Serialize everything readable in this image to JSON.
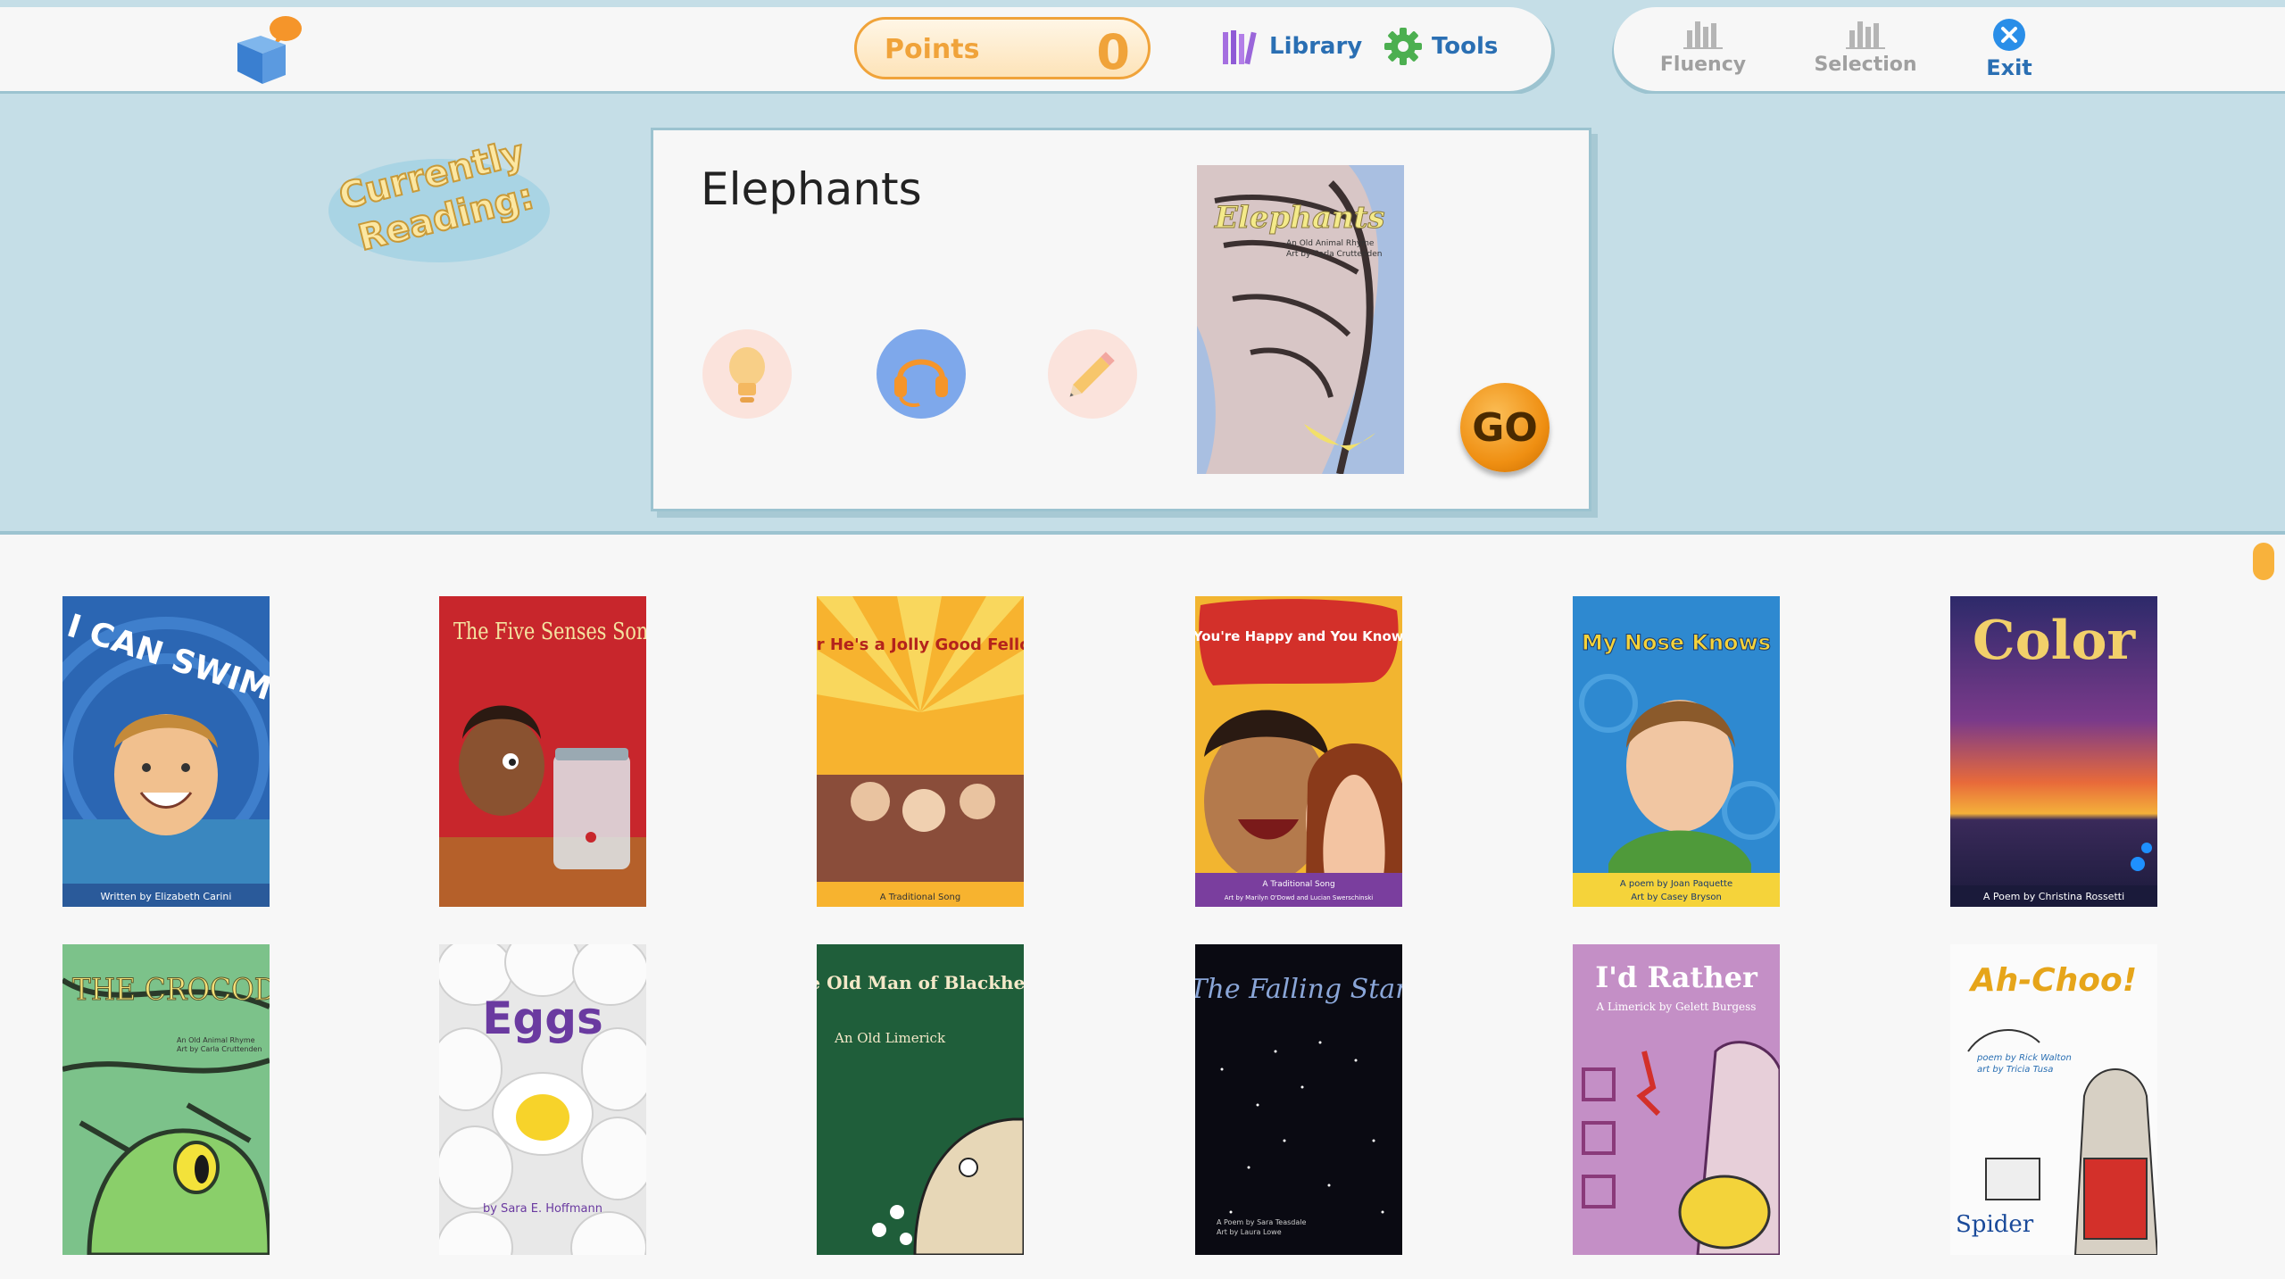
{
  "header": {
    "points_label": "Points",
    "points_value": "0",
    "library_label": "Library",
    "tools_label": "Tools",
    "fluency_label": "Fluency",
    "selection_label": "Selection",
    "exit_label": "Exit"
  },
  "current": {
    "badge_line1": "Currently",
    "badge_line2": "Reading:",
    "title": "Elephants",
    "go_label": "GO",
    "cover": {
      "title": "Elephants",
      "subtitle": "An Old Animal Rhyme",
      "credit": "Art by Carla Cruttenden"
    }
  },
  "books": [
    {
      "title": "I CAN SWIM",
      "credit": "Written by Elizabeth Carini"
    },
    {
      "title": "The Five Senses Song",
      "credit": ""
    },
    {
      "title": "For He's a Jolly Good Fellow",
      "credit": "A Traditional Song"
    },
    {
      "title": "If You're Happy and You Know It",
      "credit": "A Traditional Song",
      "credit2": "Art by Marilyn O'Dowd and Lucian Swerschinski"
    },
    {
      "title": "My Nose Knows",
      "credit": "A poem by Joan Paquette",
      "credit2": "Art by Casey Bryson"
    },
    {
      "title": "Color",
      "credit": "A Poem by Christina Rossetti"
    },
    {
      "title": "THE CROCODILE",
      "credit": "An Old Animal Rhyme",
      "credit2": "Art by Carla Cruttenden"
    },
    {
      "title": "Eggs",
      "credit": "by Sara E. Hoffmann"
    },
    {
      "title": "The Old Man of Blackheath",
      "credit": "An Old Limerick"
    },
    {
      "title": "The Falling Star",
      "credit": "A Poem by Sara Teasdale",
      "credit2": "Art by Laura Lowe"
    },
    {
      "title": "I'd Rather",
      "credit": "A Limerick by Gelett Burgess"
    },
    {
      "title": "Ah-Choo!",
      "credit": "poem by Rick Walton",
      "credit2": "art by Tricia Tusa",
      "publisher": "Spider"
    }
  ],
  "colors": {
    "accent_orange": "#f0a33a",
    "link_blue": "#2a6fb3",
    "band_blue": "#c5dee7"
  }
}
